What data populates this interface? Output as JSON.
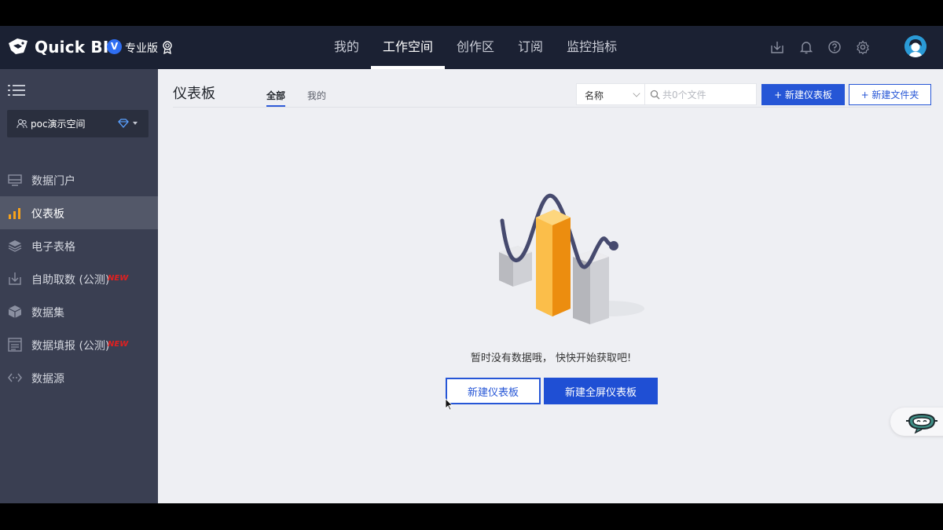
{
  "app": {
    "brand": "Quick BI",
    "edition_badge": "V",
    "edition_label": "专业版"
  },
  "nav": {
    "items": [
      {
        "label": "我的"
      },
      {
        "label": "工作空间"
      },
      {
        "label": "创作区"
      },
      {
        "label": "订阅"
      },
      {
        "label": "监控指标"
      }
    ],
    "active_index": 1
  },
  "top_icons": [
    "download-icon",
    "bell-icon",
    "help-icon",
    "settings-icon"
  ],
  "sidebar": {
    "workspace": "poc演示空间",
    "items": [
      {
        "label": "数据门户",
        "icon": "portal-icon"
      },
      {
        "label": "仪表板",
        "icon": "bar-chart-icon",
        "active": true
      },
      {
        "label": "电子表格",
        "icon": "layers-icon"
      },
      {
        "label": "自助取数 (公测)",
        "icon": "download-icon",
        "tag": "NEW"
      },
      {
        "label": "数据集",
        "icon": "cube-icon"
      },
      {
        "label": "数据填报 (公测)",
        "icon": "form-icon",
        "tag": "NEW"
      },
      {
        "label": "数据源",
        "icon": "code-icon"
      }
    ]
  },
  "main": {
    "title": "仪表板",
    "tabs": [
      {
        "label": "全部",
        "active": true
      },
      {
        "label": "我的"
      }
    ],
    "sort": {
      "value": "名称"
    },
    "search": {
      "placeholder": "共0个文件",
      "value": ""
    },
    "new_dashboard_label": "+ 新建仪表板",
    "new_folder_label": "+ 新建文件夹"
  },
  "empty_state": {
    "message": "暂时没有数据哦， 快快开始获取吧!",
    "new_dashboard_label": "新建仪表板",
    "new_fullscreen_label": "新建全屏仪表板"
  },
  "colors": {
    "topbar": "#1b2133",
    "sidebar": "#3a3f52",
    "sidebar_active": "#535869",
    "primary": "#2656d6",
    "accent_orange": "#f7a21b",
    "new_tag": "#e02020"
  }
}
